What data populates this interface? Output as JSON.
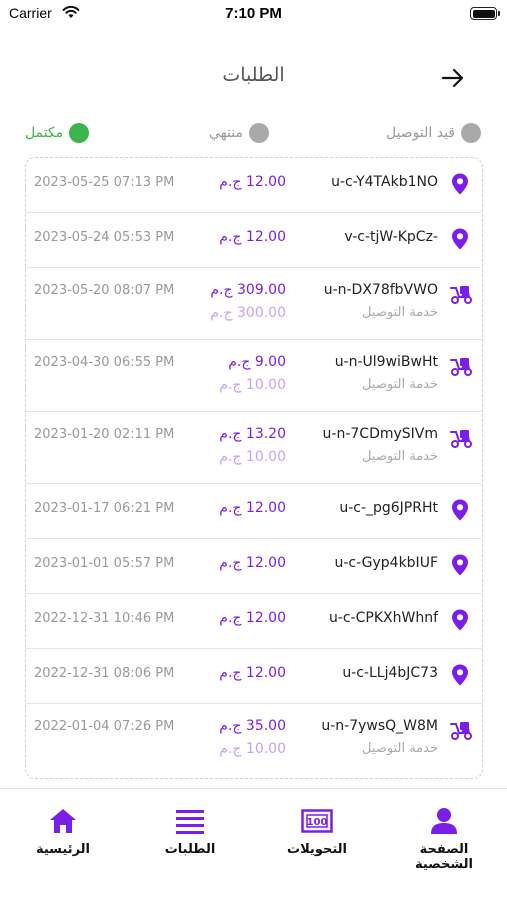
{
  "status_bar": {
    "carrier": "Carrier",
    "time": "7:10 PM"
  },
  "header": {
    "title": "الطلبات",
    "back_icon": "arrow-right-icon"
  },
  "legend": {
    "delivery": {
      "label": "قيد التوصيل",
      "color": "#a9a9a9"
    },
    "ended": {
      "label": "منتهي",
      "color": "#a9a9a9"
    },
    "complete": {
      "label": "مكتمل",
      "color": "#3cb54a"
    }
  },
  "colors": {
    "accent": "#7b1ee8",
    "accent_light": "#c5a2f2",
    "complete": "#3cb54a"
  },
  "orders": [
    {
      "code": "u-c-Y4TAkb1NO",
      "amount": "12.00 ج.م",
      "date": "2023-05-25 07:13 PM",
      "type": "pin-icon"
    },
    {
      "code": "v-c-tjW-KpCz-",
      "amount": "12.00 ج.م",
      "date": "2023-05-24 05:53 PM",
      "type": "pin-icon"
    },
    {
      "code": "u-n-DX78fbVWO",
      "amount": "309.00 ج.م",
      "date": "2023-05-20 08:07 PM",
      "type": "scooter-icon",
      "sub": "خدمة التوصيل",
      "fee": "300.00 ج.م"
    },
    {
      "code": "u-n-Ul9wiBwHt",
      "amount": "9.00 ج.م",
      "date": "2023-04-30 06:55 PM",
      "type": "scooter-icon",
      "sub": "خدمة التوصيل",
      "fee": "10.00 ج.م"
    },
    {
      "code": "u-n-7CDmySIVm",
      "amount": "13.20 ج.م",
      "date": "2023-01-20 02:11 PM",
      "type": "scooter-icon",
      "sub": "خدمة التوصيل",
      "fee": "10.00 ج.م"
    },
    {
      "code": "u-c-_pg6JPRHt",
      "amount": "12.00 ج.م",
      "date": "2023-01-17 06:21 PM",
      "type": "pin-icon"
    },
    {
      "code": "u-c-Gyp4kbIUF",
      "amount": "12.00 ج.م",
      "date": "2023-01-01 05:57 PM",
      "type": "pin-icon"
    },
    {
      "code": "u-c-CPKXhWhnf",
      "amount": "12.00 ج.م",
      "date": "2022-12-31 10:46 PM",
      "type": "pin-icon"
    },
    {
      "code": "u-c-LLj4bJC73",
      "amount": "12.00 ج.م",
      "date": "2022-12-31 08:06 PM",
      "type": "pin-icon"
    },
    {
      "code": "u-n-7ywsQ_W8M",
      "amount": "35.00 ج.م",
      "date": "2022-01-04 07:26 PM",
      "type": "scooter-icon",
      "sub": "خدمة التوصيل",
      "fee": "10.00 ج.م"
    }
  ],
  "tab_bar": {
    "home": {
      "label": "الرئيسية",
      "icon": "home-icon"
    },
    "orders": {
      "label": "الطلبات",
      "icon": "list-icon"
    },
    "transfers": {
      "label": "التحويلات",
      "icon": "money-icon"
    },
    "profile": {
      "label": "الصفحة الشخصية",
      "icon": "person-icon"
    }
  }
}
